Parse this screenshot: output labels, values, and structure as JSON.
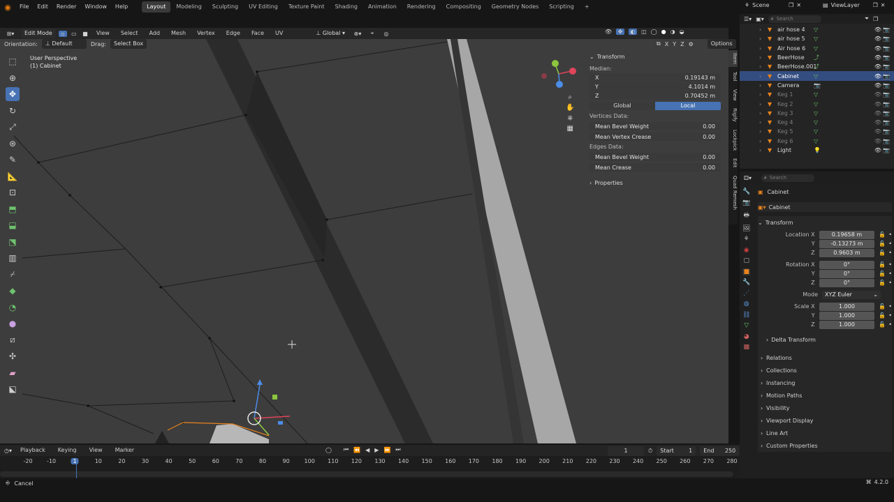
{
  "menu": [
    "File",
    "Edit",
    "Render",
    "Window",
    "Help"
  ],
  "workspaces": [
    "Layout",
    "Modeling",
    "Sculpting",
    "UV Editing",
    "Texture Paint",
    "Shading",
    "Animation",
    "Rendering",
    "Compositing",
    "Geometry Nodes",
    "Scripting"
  ],
  "active_workspace": "Layout",
  "scene": {
    "name": "Scene",
    "view_layer": "ViewLayer"
  },
  "vp_header": {
    "mode": "Edit Mode",
    "menus": [
      "View",
      "Select",
      "Add",
      "Mesh",
      "Vertex",
      "Edge",
      "Face",
      "UV"
    ],
    "transform_orientation": "Global"
  },
  "vp_header2": {
    "orientation_label": "Orientation:",
    "orientation_value": "Default",
    "drag_label": "Drag:",
    "drag_value": "Select Box",
    "options": "Options",
    "axes": [
      "X",
      "Y",
      "Z"
    ]
  },
  "viewport": {
    "perspective": "User Perspective",
    "object": "(1) Cabinet"
  },
  "npanel": {
    "title": "Transform",
    "median_label": "Median:",
    "median": [
      {
        "axis": "X",
        "value": "0.19143 m"
      },
      {
        "axis": "Y",
        "value": "4.1014 m"
      },
      {
        "axis": "Z",
        "value": "0.70452 m"
      }
    ],
    "space_global": "Global",
    "space_local": "Local",
    "vertices_label": "Vertices Data:",
    "vertices": [
      {
        "label": "Mean Bevel Weight",
        "value": "0.00"
      },
      {
        "label": "Mean Vertex Crease",
        "value": "0.00"
      }
    ],
    "edges_label": "Edges Data:",
    "edges": [
      {
        "label": "Mean Bevel Weight",
        "value": "0.00"
      },
      {
        "label": "Mean Crease",
        "value": "0.00"
      }
    ],
    "properties": "Properties"
  },
  "side_tabs": [
    "Item",
    "Tool",
    "View",
    "Rigify",
    "Lockpick",
    "Edit",
    "Quad Remesh"
  ],
  "outliner": {
    "search_placeholder": "Search",
    "items": [
      {
        "name": "air hose 4",
        "state": "normal"
      },
      {
        "name": "air hose 5",
        "state": "normal"
      },
      {
        "name": "Air hose 6",
        "state": "normal"
      },
      {
        "name": "BeerHose",
        "state": "normal"
      },
      {
        "name": "BeerHose.001",
        "state": "normal"
      },
      {
        "name": "Cabinet",
        "state": "selected"
      },
      {
        "name": "Camera",
        "state": "normal"
      },
      {
        "name": "Keg 1",
        "state": "dim"
      },
      {
        "name": "Keg 2",
        "state": "dim"
      },
      {
        "name": "Keg 3",
        "state": "dim"
      },
      {
        "name": "Keg 4",
        "state": "dim"
      },
      {
        "name": "Keg 5",
        "state": "dim"
      },
      {
        "name": "Keg 6",
        "state": "dim"
      },
      {
        "name": "Light",
        "state": "normal"
      }
    ]
  },
  "props": {
    "search_placeholder": "Search",
    "object_name": "Cabinet",
    "object_data": "Cabinet",
    "transform": "Transform",
    "location_label": "Location X",
    "location": [
      "0.19658 m",
      "-0.13273 m",
      "0.9603 m"
    ],
    "rotation_label": "Rotation X",
    "rotation": [
      "0°",
      "0°",
      "0°"
    ],
    "mode_label": "Mode",
    "mode_value": "XYZ Euler",
    "scale_label": "Scale X",
    "scale": [
      "1.000",
      "1.000",
      "1.000"
    ],
    "y": "Y",
    "z": "Z",
    "delta": "Delta Transform",
    "sections": [
      "Relations",
      "Collections",
      "Instancing",
      "Motion Paths",
      "Visibility",
      "Viewport Display",
      "Line Art",
      "Custom Properties"
    ]
  },
  "timeline": {
    "menus": [
      "Playback",
      "Keying",
      "View",
      "Marker"
    ],
    "current_frame": "1",
    "start_label": "Start",
    "start": "1",
    "end_label": "End",
    "end": "250",
    "ticks": [
      "-20",
      "-10",
      "1",
      "10",
      "20",
      "30",
      "40",
      "50",
      "60",
      "70",
      "80",
      "90",
      "100",
      "110",
      "120",
      "130",
      "140",
      "150",
      "160",
      "170",
      "180",
      "190",
      "200",
      "210",
      "220",
      "230",
      "240",
      "250",
      "260",
      "270",
      "280"
    ]
  },
  "status": {
    "left": "Cancel",
    "version": "4.2.0"
  }
}
